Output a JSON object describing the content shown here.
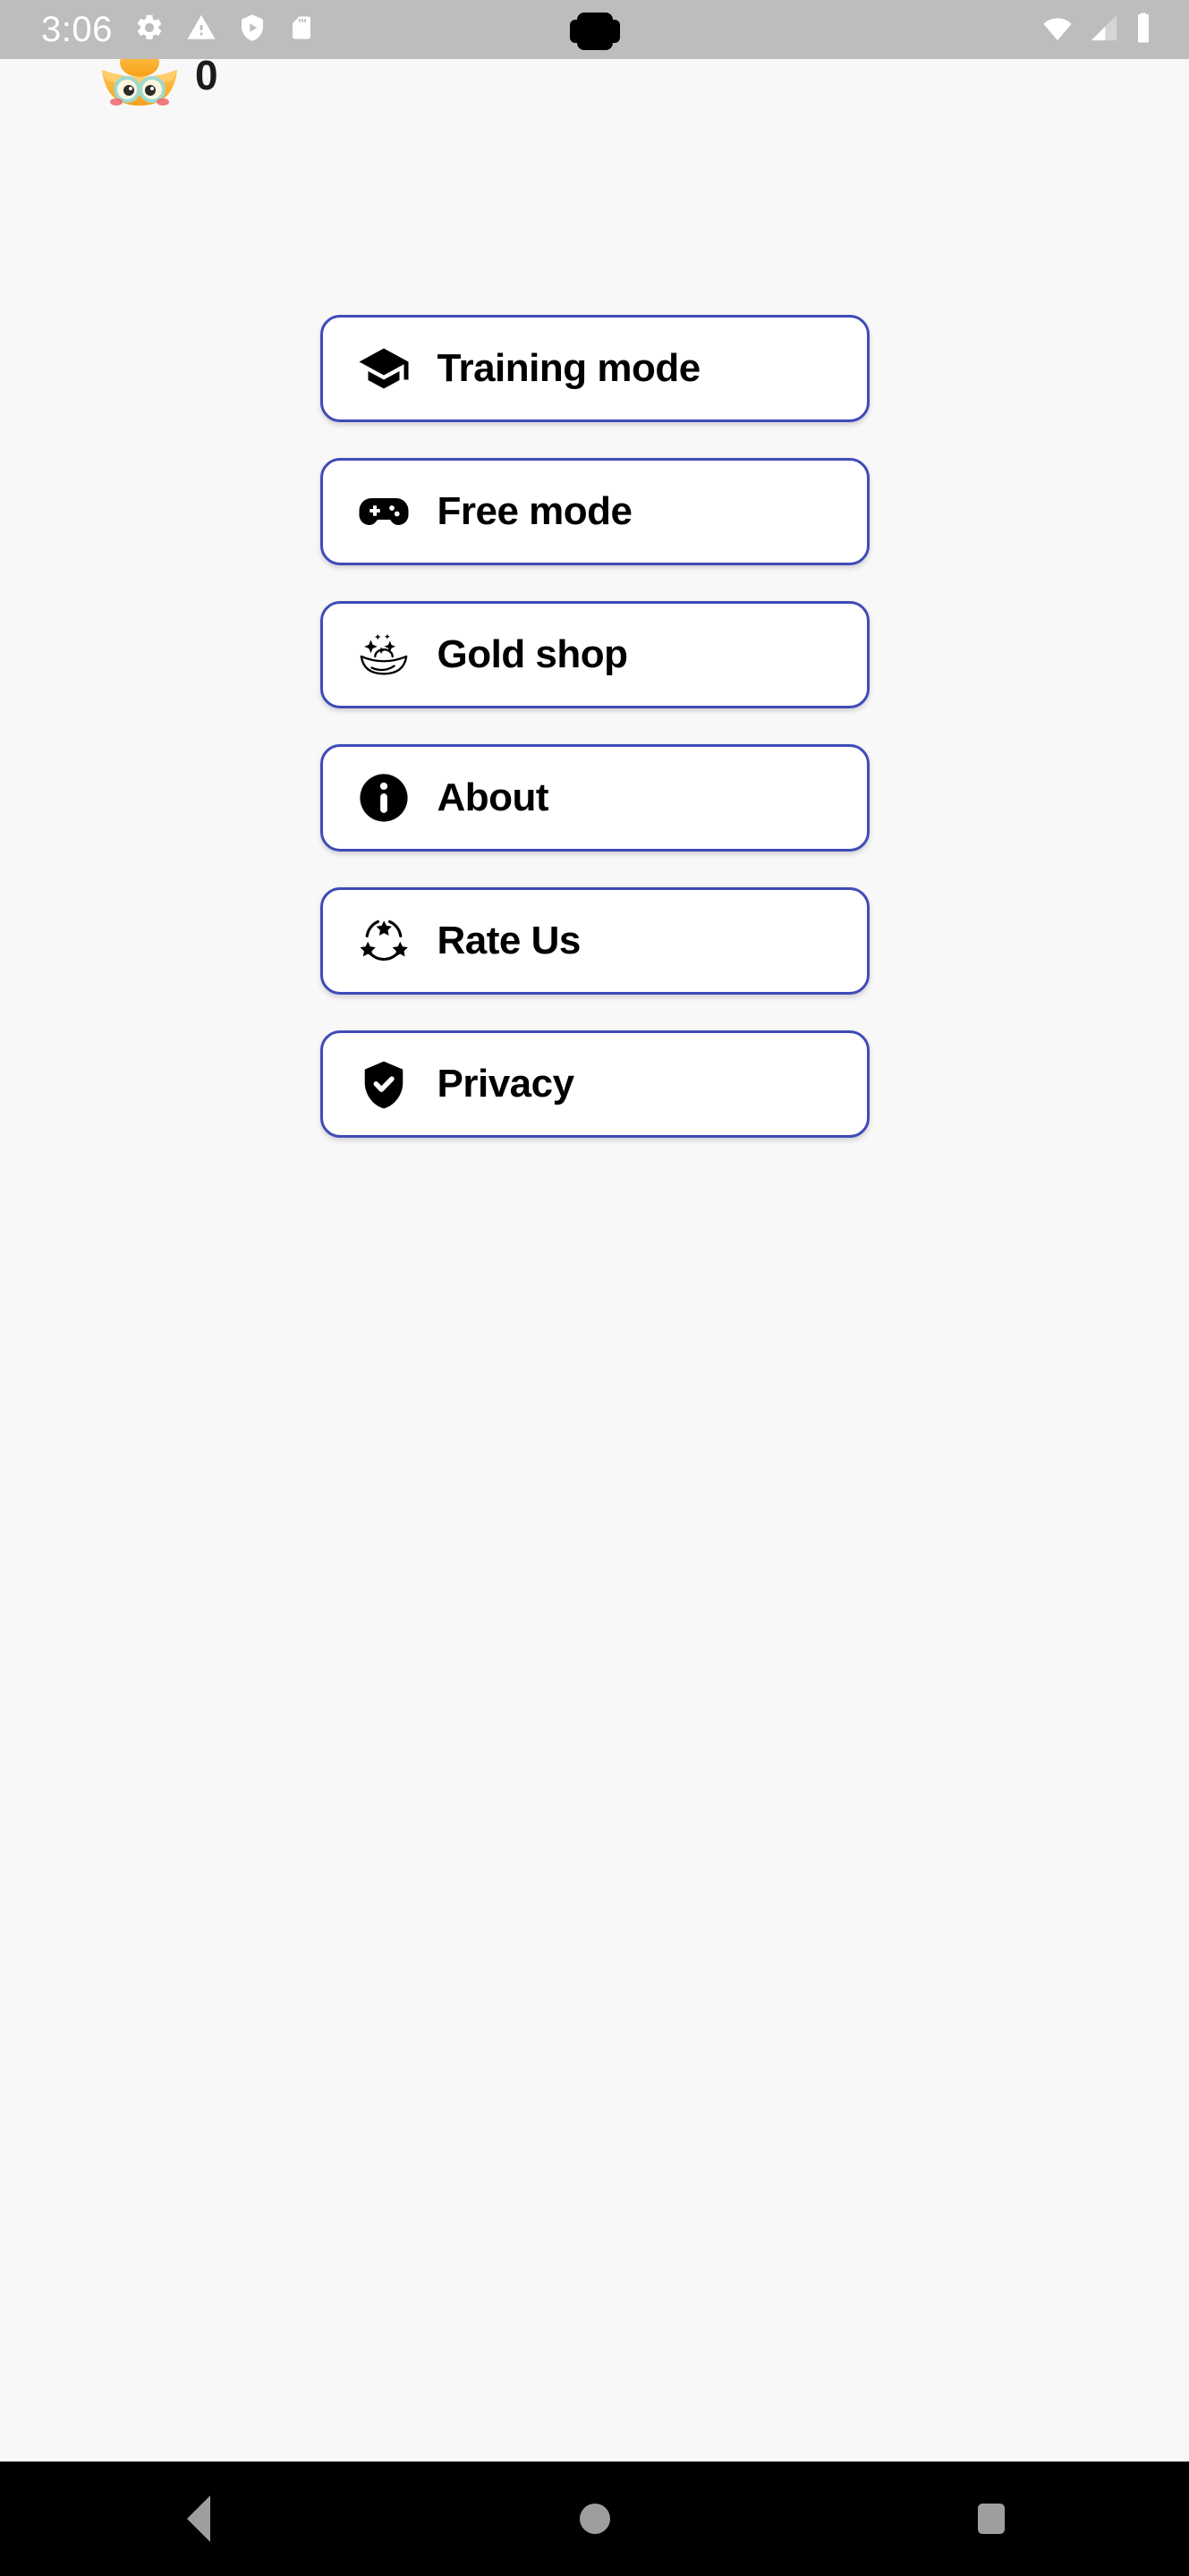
{
  "status_bar": {
    "time": "3:06",
    "left_icons": [
      "gear-icon",
      "warning-triangle-icon",
      "shield-play-icon",
      "sd-card-icon"
    ],
    "right_icons": [
      "wifi-icon",
      "cellular-signal-icon",
      "battery-icon"
    ],
    "background_color": "#bdbdbd",
    "icon_color": "#ffffff"
  },
  "gold_counter": {
    "avatar_icon": "gold-ingot-mascot-icon",
    "count": "0",
    "count_color": "#1b1b1b"
  },
  "menu": {
    "accent_border_color": "#3f4bb8",
    "button_background": "#ffffff",
    "items": [
      {
        "label": "Training mode",
        "icon": "graduation-cap-icon"
      },
      {
        "label": "Free mode",
        "icon": "gamepad-icon"
      },
      {
        "label": "Gold shop",
        "icon": "gold-ingot-sparkle-icon"
      },
      {
        "label": "About",
        "icon": "info-circle-icon"
      },
      {
        "label": "Rate Us",
        "icon": "three-stars-rating-icon"
      },
      {
        "label": "Privacy",
        "icon": "shield-check-icon"
      }
    ]
  },
  "navigation_bar": {
    "background_color": "#000000",
    "icon_color": "#9e9e9e",
    "items": [
      {
        "name": "back-button",
        "icon": "back-triangle-icon"
      },
      {
        "name": "home-button",
        "icon": "home-circle-icon"
      },
      {
        "name": "recents-button",
        "icon": "recents-square-icon"
      }
    ]
  },
  "page": {
    "background_color": "#f8f8f8"
  }
}
